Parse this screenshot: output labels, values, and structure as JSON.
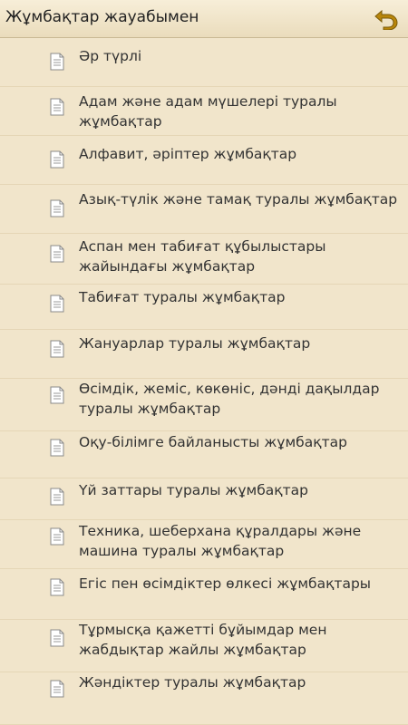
{
  "header": {
    "title": "Жұмбақтар жауабымен",
    "back_icon": "back-arrow-icon",
    "accent": "#b8860b"
  },
  "list": {
    "item_icon": "document-icon",
    "items": [
      {
        "label": "Әр түрлі"
      },
      {
        "label": "Адам және адам мүшелері туралы жұмбақтар"
      },
      {
        "label": "Алфавит, әріптер жұмбақтар"
      },
      {
        "label": "Азық-түлік және тамақ туралы жұмбақтар"
      },
      {
        "label": "Аспан мен табиғат құбылыстары жайындағы жұмбақтар"
      },
      {
        "label": "Табиғат туралы жұмбақтар"
      },
      {
        "label": "Жануарлар туралы жұмбақтар"
      },
      {
        "label": "Өсімдік, жеміс, көкөніс, дәнді дақылдар туралы жұмбақтар"
      },
      {
        "label": "Оқу-білімге байланысты жұмбақтар"
      },
      {
        "label": "Үй заттары туралы жұмбақтар"
      },
      {
        "label": "Техника, шеберхана құралдары және машина туралы жұмбақтар"
      },
      {
        "label": "Егіс пен өсімдіктер өлкесі жұмбақтары"
      },
      {
        "label": "Тұрмысқа қажетті бұйымдар мен жабдықтар жайлы жұмбақтар"
      },
      {
        "label": "Жәндіктер туралы жұмбақтар"
      }
    ]
  }
}
